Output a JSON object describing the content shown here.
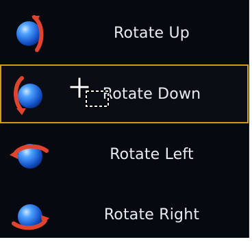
{
  "menu": {
    "items": [
      {
        "label": "Rotate Up",
        "icon": "rotate-up-icon",
        "selected": false
      },
      {
        "label": "Rotate Down",
        "icon": "rotate-down-icon",
        "selected": true
      },
      {
        "label": "Rotate Left",
        "icon": "rotate-left-icon",
        "selected": false
      },
      {
        "label": "Rotate Right",
        "icon": "rotate-right-icon",
        "selected": false
      }
    ]
  },
  "colors": {
    "background": "#06090f",
    "selection_border": "#d19a1a",
    "sphere_blue": "#1f6fe6",
    "arrow_red": "#e0442e"
  },
  "cursor": {
    "icon": "drag-copy-cursor-icon"
  }
}
